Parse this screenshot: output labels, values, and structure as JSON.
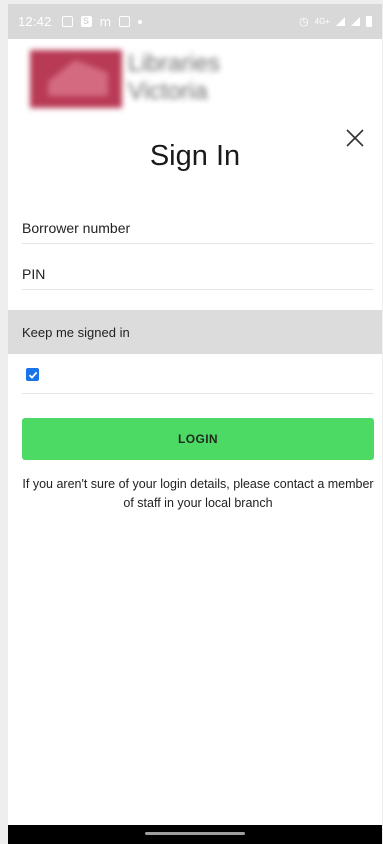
{
  "status_bar": {
    "time": "12:42",
    "network": "4G+",
    "icons": [
      "notification-icon",
      "s-app-icon",
      "mcdonalds-icon",
      "message-icon",
      "dot-icon",
      "alarm-icon",
      "signal-icon",
      "battery-icon"
    ]
  },
  "logo": {
    "line1": "Libraries",
    "line2": "Victoria"
  },
  "header": {
    "title": "Sign In",
    "close_icon": "close-icon"
  },
  "form": {
    "borrower_placeholder": "Borrower number",
    "pin_placeholder": "PIN",
    "keep_signed_label": "Keep me signed in",
    "keep_signed_checked": true,
    "login_label": "LOGIN",
    "help_text": "If you aren't sure of your login details, please contact a member of staff in your local branch"
  },
  "colors": {
    "accent_green": "#4cd964",
    "checkbox_blue": "#1a73e8",
    "section_gray": "#dcdcdc"
  }
}
